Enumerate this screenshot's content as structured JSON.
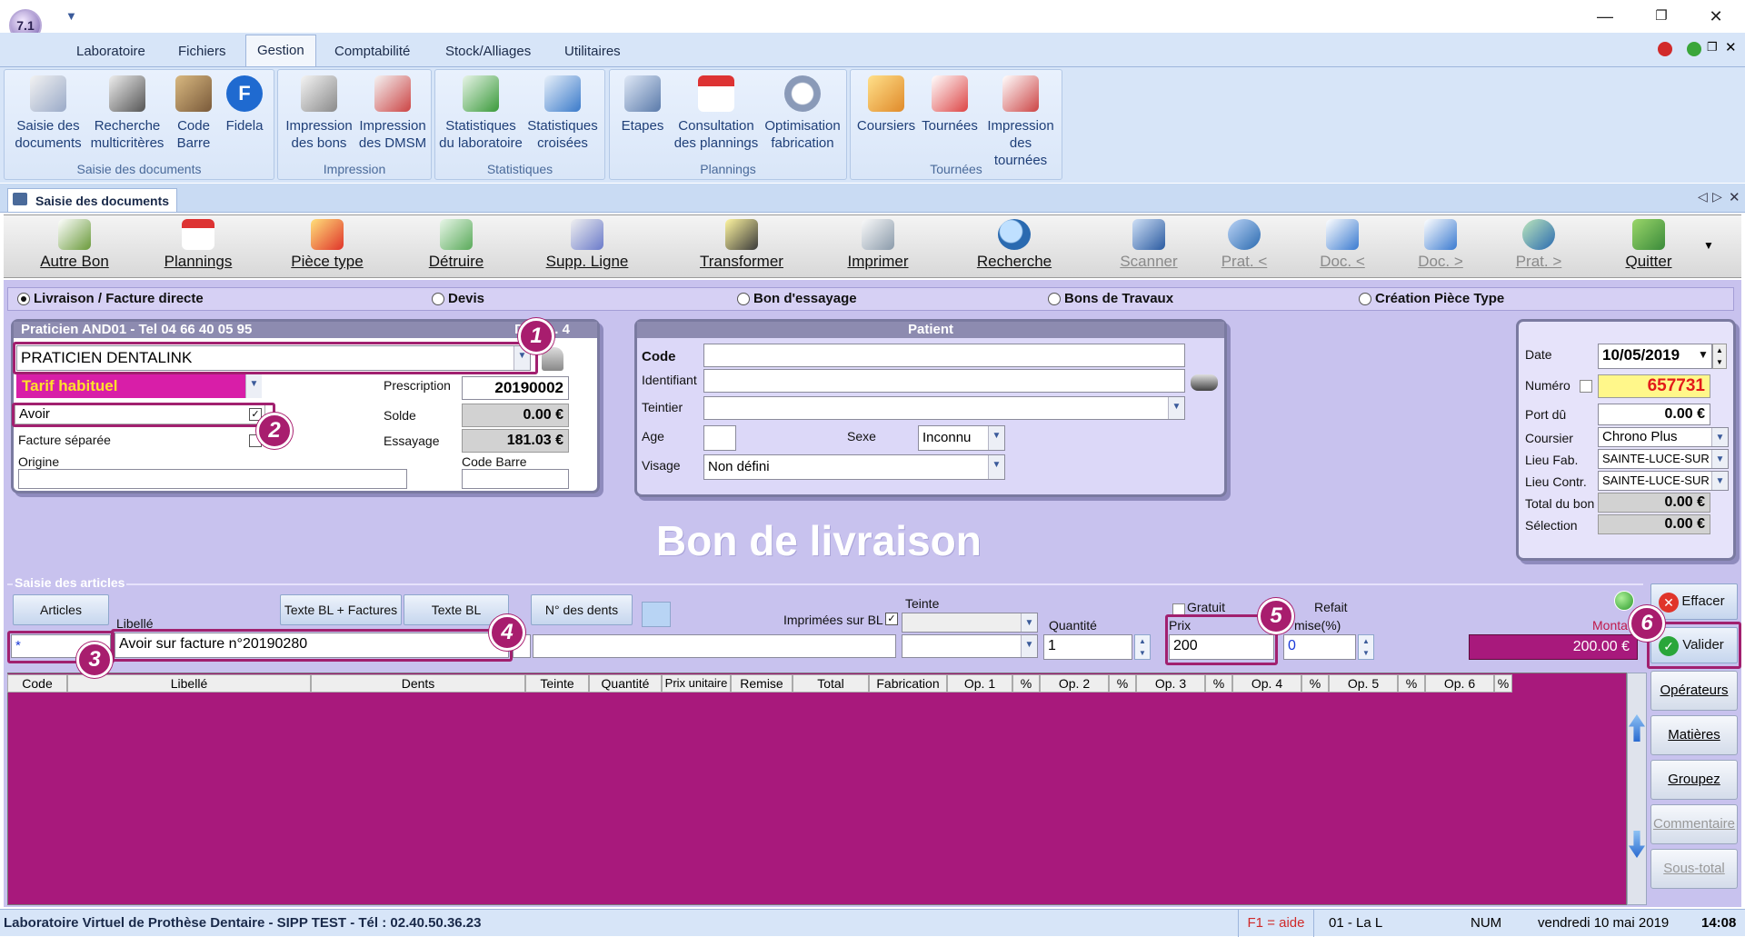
{
  "app": {
    "logo_text": "7.1"
  },
  "menu": [
    "Laboratoire",
    "Fichiers",
    "Gestion",
    "Comptabilité",
    "Stock/Alliages",
    "Utilitaires"
  ],
  "ribbon": {
    "groups": [
      "Saisie des documents",
      "Impression",
      "Statistiques",
      "Plannings",
      "Tournées"
    ],
    "buttons": [
      {
        "l1": "Saisie des",
        "l2": "documents"
      },
      {
        "l1": "Recherche",
        "l2": "multicritères"
      },
      {
        "l1": "Code",
        "l2": "Barre"
      },
      {
        "l1": "Fidela",
        "l2": ""
      },
      {
        "l1": "Impression",
        "l2": "des bons"
      },
      {
        "l1": "Impression",
        "l2": "des DMSM"
      },
      {
        "l1": "Statistiques",
        "l2": "du laboratoire"
      },
      {
        "l1": "Statistiques",
        "l2": "croisées"
      },
      {
        "l1": "Etapes",
        "l2": ""
      },
      {
        "l1": "Consultation",
        "l2": "des plannings"
      },
      {
        "l1": "Optimisation",
        "l2": "fabrication"
      },
      {
        "l1": "Coursiers",
        "l2": ""
      },
      {
        "l1": "Tournées",
        "l2": ""
      },
      {
        "l1": "Impression",
        "l2": "des tournées"
      }
    ]
  },
  "doc_tab": "Saisie des documents",
  "toolbar": [
    "Autre Bon",
    "Plannings",
    "Pièce type",
    "Détruire",
    "Supp. Ligne",
    "Transformer",
    "Imprimer",
    "Recherche",
    "Scanner",
    "Prat. <",
    "Doc. <",
    "Doc. >",
    "Prat. >",
    "Quitter"
  ],
  "radios": [
    "Livraison / Facture directe",
    "Devis",
    "Bon d'essayage",
    "Bons de Travaux",
    "Création Pièce Type"
  ],
  "praticien": {
    "header": "Praticien AND01 - Tel 04 66 40 05 95",
    "header_right": "Déjà ... 4",
    "name": "PRATICIEN DENTALINK",
    "tarif": "Tarif habituel",
    "avoir": "Avoir",
    "facture_separee": "Facture séparée",
    "origine": "Origine",
    "prescription_label": "Prescription",
    "prescription": "20190002",
    "solde_label": "Solde",
    "solde": "0.00 €",
    "essayage_label": "Essayage",
    "essayage": "181.03 €",
    "codebarre_label": "Code Barre"
  },
  "patient": {
    "header": "Patient",
    "code": "Code",
    "identifiant": "Identifiant",
    "teintier": "Teintier",
    "age": "Age",
    "sexe": "Sexe",
    "sexe_value": "Inconnu",
    "visage": "Visage",
    "visage_value": "Non défini"
  },
  "doc_title": "Bon de livraison",
  "right": {
    "date_label": "Date",
    "date": "10/05/2019",
    "numero_label": "Numéro",
    "numero": "657731",
    "port_label": "Port dû",
    "port": "0.00 €",
    "coursier_label": "Coursier",
    "coursier": "Chrono Plus",
    "lieufab_label": "Lieu Fab.",
    "lieufab": "SAINTE-LUCE-SUR",
    "lieucontr_label": "Lieu Contr.",
    "lieucontr": "SAINTE-LUCE-SUR",
    "total_label": "Total du bon",
    "total": "0.00 €",
    "selection_label": "Sélection",
    "selection": "0.00 €"
  },
  "saisie": {
    "title": "Saisie des articles",
    "articles_btn": "Articles",
    "libelle_label": "Libellé",
    "texte_bl_factures": "Texte BL + Factures",
    "texte_bl": "Texte BL",
    "n_dents": "N° des dents",
    "imprimees": "Imprimées sur BL",
    "teinte": "Teinte",
    "quantite": "Quantité",
    "gratuit": "Gratuit",
    "refait": "Refait",
    "prix": "Prix",
    "remise": "mise(%)",
    "montant_label": "Monta",
    "montant": "200.00 €",
    "code_value": "*",
    "libelle_value": "Avoir sur facture n°20190280",
    "qte_value": "1",
    "prix_value": "200",
    "remise_value": "0",
    "effacer": "Effacer",
    "valider": "Valider"
  },
  "grid_headers": [
    "Code",
    "Libellé",
    "Dents",
    "Teinte",
    "Quantité",
    "Prix unitaire",
    "Remise",
    "Total",
    "Fabrication",
    "Op. 1",
    "%",
    "Op. 2",
    "%",
    "Op. 3",
    "%",
    "Op. 4",
    "%",
    "Op. 5",
    "%",
    "Op. 6",
    "%"
  ],
  "side_buttons": [
    "Opérateurs",
    "Matières",
    "Groupez",
    "Commentaire",
    "Sous-total"
  ],
  "badges": [
    "1",
    "2",
    "3",
    "4",
    "5",
    "6"
  ],
  "status": {
    "left": "Laboratoire Virtuel de Prothèse Dentaire - SIPP TEST - Tél : 02.40.50.36.23",
    "help": "F1 = aide",
    "user": "01 - La L",
    "num": "NUM",
    "date": "vendredi 10 mai 2019",
    "time": "14:08"
  },
  "colors": {
    "accent": "#a81d6e",
    "grid_bg": "#a8197c",
    "panel_bg": "#c8c2ee",
    "ribbon": "#d7e5f8"
  }
}
